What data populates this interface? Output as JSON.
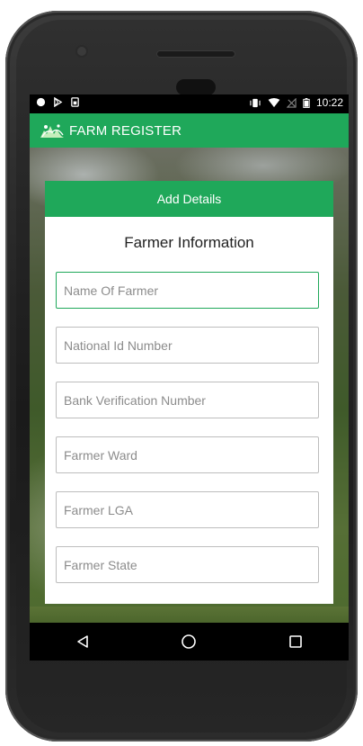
{
  "status_bar": {
    "time": "10:22",
    "left_icons": [
      "record-icon",
      "play-store-icon",
      "sim-icon"
    ],
    "right_icons": [
      "vibrate-icon",
      "wifi-icon",
      "no-signal-icon",
      "battery-icon"
    ]
  },
  "app_bar": {
    "title": "FARM REGISTER",
    "logo_icon": "farm-logo-icon"
  },
  "card": {
    "header": "Add Details",
    "title": "Farmer Information",
    "fields": [
      {
        "placeholder": "Name Of Farmer",
        "value": "",
        "focused": true
      },
      {
        "placeholder": "National Id Number",
        "value": ""
      },
      {
        "placeholder": "Bank Verification Number",
        "value": ""
      },
      {
        "placeholder": "Farmer Ward",
        "value": ""
      },
      {
        "placeholder": "Farmer LGA",
        "value": ""
      },
      {
        "placeholder": "Farmer State",
        "value": ""
      }
    ]
  },
  "nav_bar": {
    "icons": [
      "back-icon",
      "home-icon",
      "recents-icon"
    ]
  },
  "colors": {
    "accent": "#1fa85a",
    "status_bar": "#000000",
    "field_border": "#bdbdbd"
  }
}
